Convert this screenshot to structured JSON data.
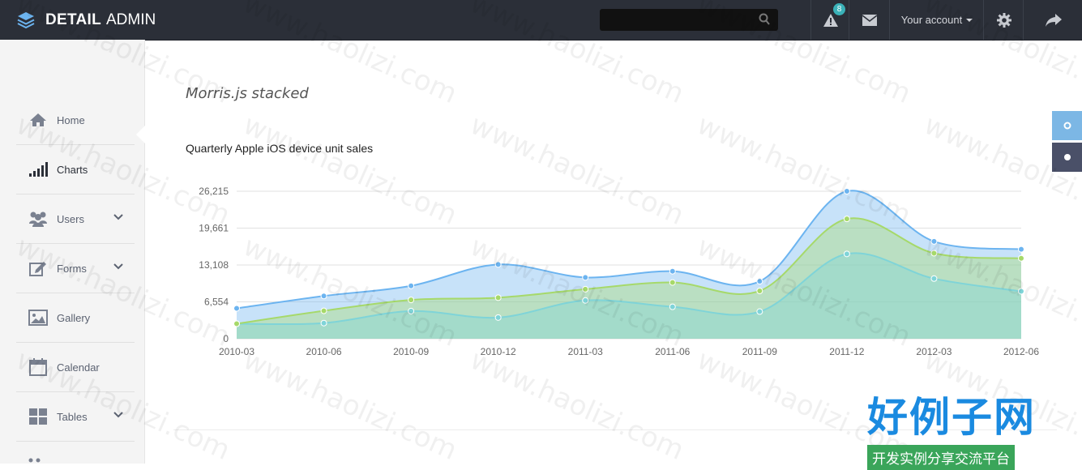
{
  "brand": {
    "title_bold": "DETAIL",
    "title_light": "ADMIN"
  },
  "topbar": {
    "notifications_count": "8",
    "account_label": "Your account"
  },
  "sidebar": {
    "items": [
      {
        "label": "Home",
        "icon": "home-icon"
      },
      {
        "label": "Charts",
        "icon": "bar-chart-icon",
        "active": true
      },
      {
        "label": "Users",
        "icon": "users-icon",
        "expandable": true
      },
      {
        "label": "Forms",
        "icon": "edit-icon",
        "expandable": true
      },
      {
        "label": "Gallery",
        "icon": "image-icon"
      },
      {
        "label": "Calendar",
        "icon": "calendar-icon"
      },
      {
        "label": "Tables",
        "icon": "grid-icon",
        "expandable": true
      }
    ]
  },
  "page": {
    "section_title": "Morris.js stacked",
    "chart_title": "Quarterly Apple iOS device unit sales"
  },
  "chart_data": {
    "type": "area",
    "title": "Quarterly Apple iOS device unit sales",
    "categories": [
      "2010-03",
      "2010-06",
      "2010-09",
      "2010-12",
      "2011-03",
      "2011-06",
      "2011-09",
      "2011-12",
      "2012-03",
      "2012-06"
    ],
    "y_ticks": [
      "0",
      "6,554",
      "13,108",
      "19,661",
      "26,215"
    ],
    "ylim": [
      0,
      26215
    ],
    "grid": true,
    "series": [
      {
        "values": [
          2666,
          2778,
          4912,
          3767,
          6810,
          5670,
          4820,
          15073,
          10687,
          8432
        ],
        "color": "#7fd4d8"
      },
      {
        "values": [
          2666,
          4960,
          6900,
          7300,
          8800,
          10000,
          8500,
          21300,
          15200,
          14300
        ],
        "color": "#a6d96a"
      },
      {
        "values": [
          5400,
          7600,
          9400,
          13200,
          10900,
          12000,
          10200,
          26215,
          17300,
          15900
        ],
        "color": "#6cb4f0"
      }
    ]
  },
  "watermark": {
    "text": "www.haolizi.com",
    "logo_cn": "好例子网",
    "logo_tag": "开发实例分享交流平台"
  }
}
